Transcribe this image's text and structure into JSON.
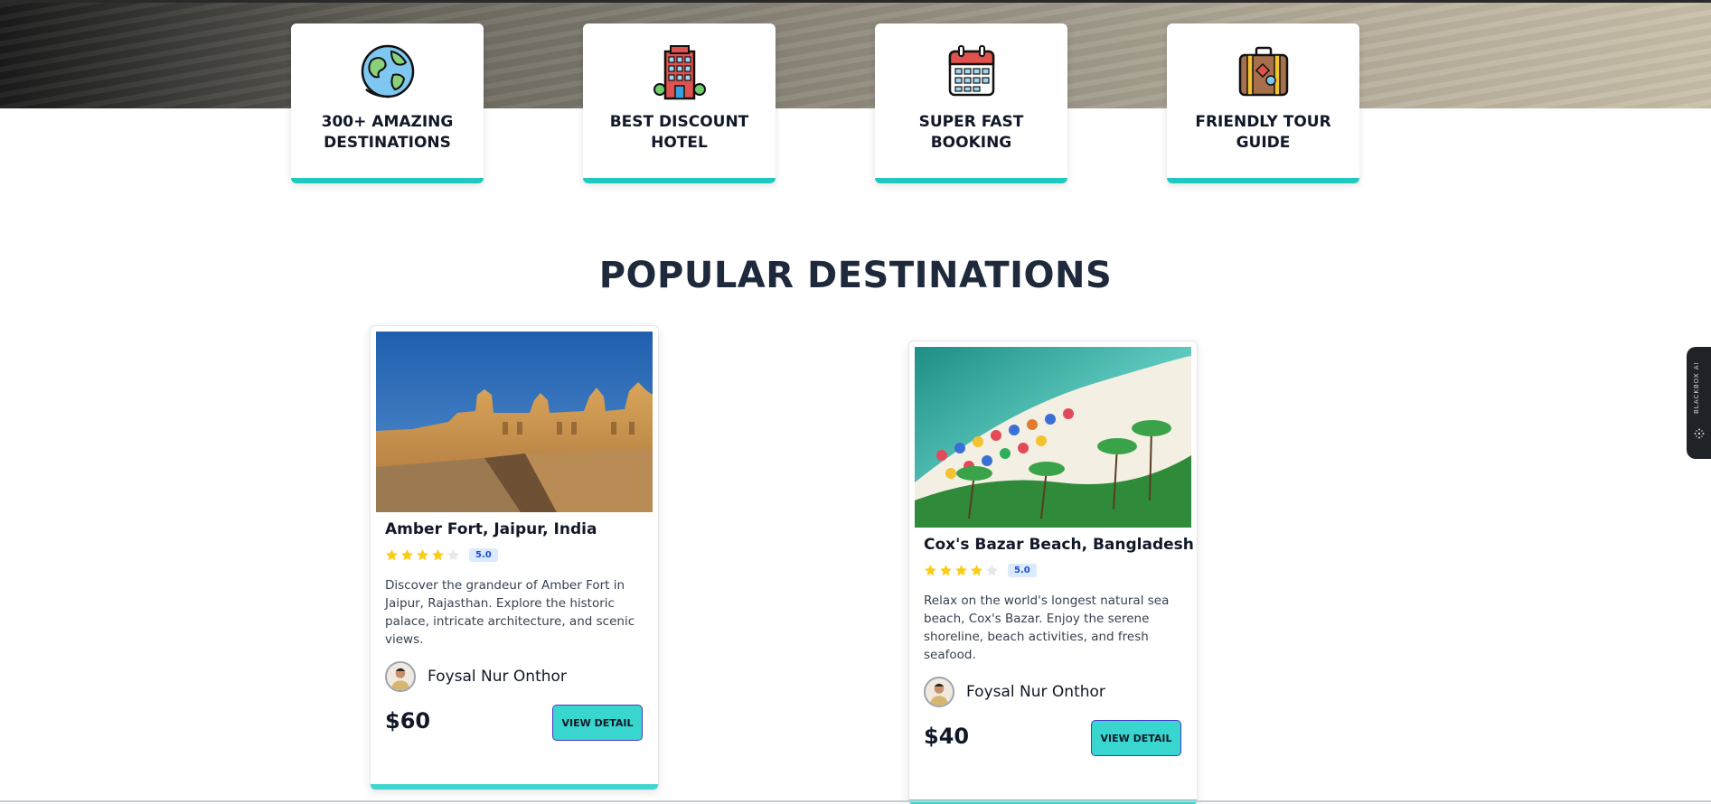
{
  "features": [
    {
      "title": "300+ AMAZING DESTINATIONS",
      "icon": "globe-icon"
    },
    {
      "title": "BEST DISCOUNT HOTEL",
      "icon": "hotel-icon"
    },
    {
      "title": "SUPER FAST BOOKING",
      "icon": "calendar-icon"
    },
    {
      "title": "FRIENDLY TOUR GUIDE",
      "icon": "suitcase-icon"
    }
  ],
  "section": {
    "title": "POPULAR DESTINATIONS"
  },
  "destinations": [
    {
      "title": "Amber Fort, Jaipur, India",
      "stars_filled": 4,
      "stars_total": 5,
      "rating": "5.0",
      "description": "Discover the grandeur of Amber Fort in Jaipur, Rajasthan. Explore the historic palace, intricate architecture, and scenic views.",
      "author": "Foysal Nur Onthor",
      "price": "$60",
      "button": "VIEW DETAIL"
    },
    {
      "title": "Cox's Bazar Beach, Bangladesh",
      "stars_filled": 4,
      "stars_total": 5,
      "rating": "5.0",
      "description": "Relax on the world's longest natural sea beach, Cox's Bazar. Enjoy the serene shoreline, beach activities, and fresh seafood.",
      "author": "Foysal Nur Onthor",
      "price": "$40",
      "button": "VIEW DETAIL"
    }
  ],
  "side_widget": {
    "label": "BLACKBOX AI"
  },
  "colors": {
    "accent": "#20c9c0",
    "button": "#38d6cf",
    "star": "#facc15",
    "heading": "#1e293b"
  }
}
